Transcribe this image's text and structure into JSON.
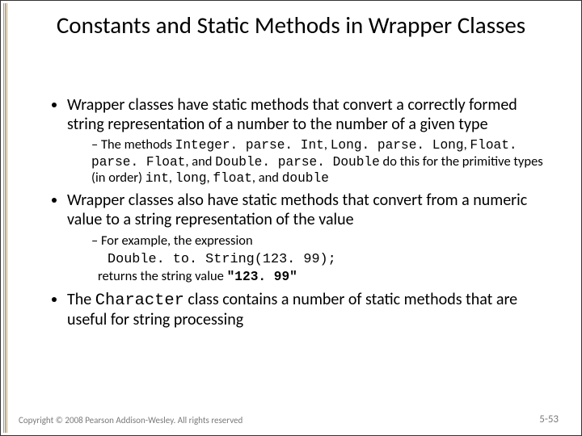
{
  "title": "Constants and Static Methods in Wrapper Classes",
  "bullets": {
    "b1": "Wrapper classes have static methods that convert a correctly formed string representation of a number to the number of a given type",
    "b1_sub_a": "The methods ",
    "b1_sub_b": ", ",
    "b1_sub_c": ", ",
    "b1_sub_d": ", and ",
    "b1_sub_e": " do this for the primitive types (in order) ",
    "b1_sub_f": ", ",
    "b1_sub_g": ", ",
    "b1_sub_h": ", and ",
    "code_integer": "Integer. parse. Int",
    "code_long": "Long. parse. Long",
    "code_float": "Float. parse. Float",
    "code_double": "Double. parse. Double",
    "code_int_t": "int",
    "code_long_t": "long",
    "code_float_t": "float",
    "code_double_t": "double",
    "b2": "Wrapper classes also have static methods that convert from a numeric value to a string representation of the value",
    "b2_sub": "For example, the expression",
    "b2_code": "Double. to. String(123. 99);",
    "b2_ret_a": "returns the string value ",
    "b2_ret_b": "\"123. 99\"",
    "b3_a": "The ",
    "b3_code": "Character",
    "b3_b": " class contains a number of static methods that are useful for string processing"
  },
  "footer": {
    "copyright": "Copyright © 2008 Pearson Addison-Wesley. All rights reserved",
    "page": "5-53"
  }
}
